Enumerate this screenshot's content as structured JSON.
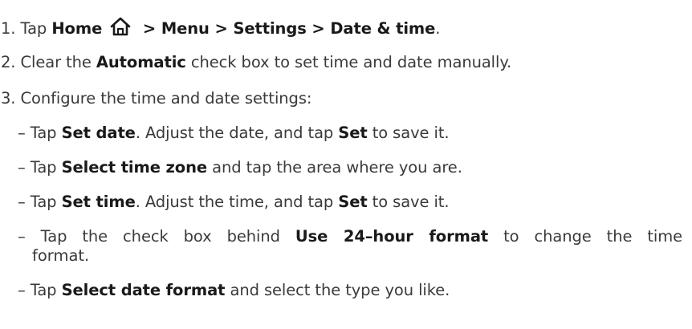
{
  "steps": {
    "s1": {
      "num": "1. Tap ",
      "home": "Home",
      "icon": "home-icon",
      "sep1": " > ",
      "menu": "Menu",
      "sep2": " > ",
      "settings": "Settings",
      "sep3": " > ",
      "datetime": "Date & time",
      "end": "."
    },
    "s2": {
      "pre": "2. Clear the ",
      "automatic": "Automatic",
      "post": " check box to set time and date manually."
    },
    "s3": {
      "text": "3. Configure the time and date settings:"
    }
  },
  "bullets": {
    "b1": {
      "pre": "– Tap ",
      "k1": "Set date",
      "mid": ". Adjust the date, and tap ",
      "k2": "Set",
      "post": " to save it."
    },
    "b2": {
      "pre": "– Tap ",
      "k1": "Select time zone",
      "post": " and tap the area where you are."
    },
    "b3": {
      "pre": "– Tap ",
      "k1": "Set time",
      "mid": ". Adjust the time, and tap ",
      "k2": "Set",
      "post": " to save it."
    },
    "b4": {
      "pre": "– Tap the check box behind ",
      "k1": "Use 24–hour format",
      "post": " to change the time",
      "cont": "format."
    },
    "b5": {
      "pre": "– Tap ",
      "k1": "Select date format",
      "post": " and select the type you like."
    }
  }
}
